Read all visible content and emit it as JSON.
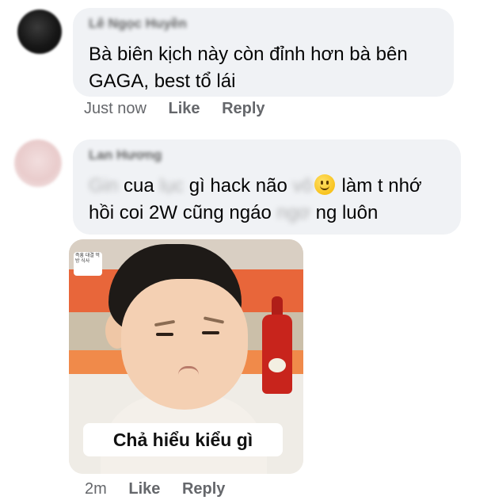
{
  "comments": [
    {
      "author": "Lê Ngọc Huyền",
      "text_line1": "Bà biên kịch này còn đỉnh hơn bà bên",
      "text_line2": "GAGA, best tổ lái",
      "time": "Just now",
      "like_label": "Like",
      "reply_label": "Reply"
    },
    {
      "author": "Lan Hương",
      "text_segments": [
        "Gin",
        " cua ",
        "lục",
        " gì hack não ",
        "vô",
        "làm t nhớ"
      ],
      "text_line2_segments": [
        "hồi coi 2W cũng ngáo ",
        "ngơ",
        " ng luôn"
      ],
      "emoji": "slightly-smiling-face-icon",
      "photo_caption": "Chả hiểu kiểu gì",
      "photo_tag": "즉흥 대결 먹방 식사",
      "time": "2m",
      "like_label": "Like",
      "reply_label": "Reply"
    }
  ],
  "colors": {
    "bubble": "#f0f2f5",
    "meta_text": "#65676b",
    "text": "#050505"
  }
}
